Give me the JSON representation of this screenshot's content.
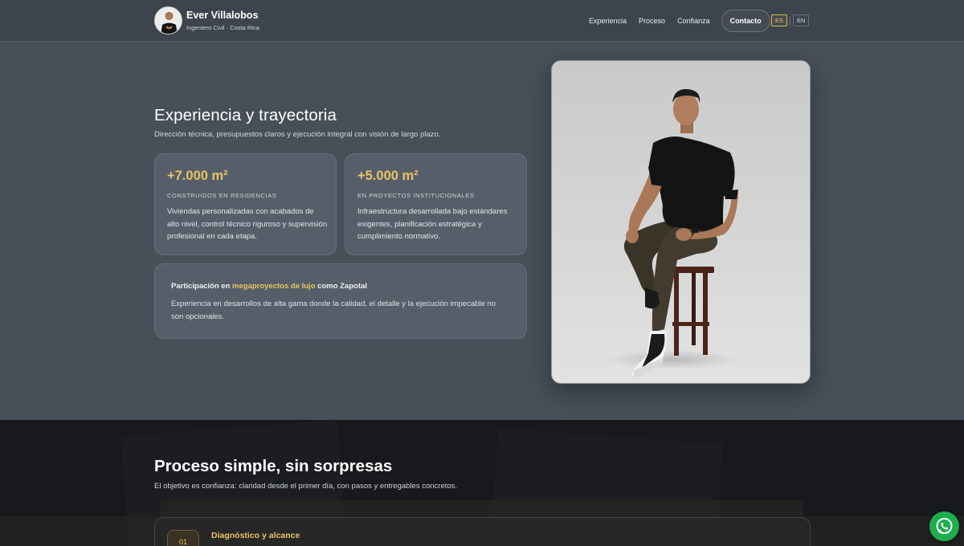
{
  "header": {
    "name": "Ever Villalobos",
    "subtitle": "Ingeniero Civil · Costa Rica",
    "nav": [
      "Experiencia",
      "Proceso",
      "Confianza"
    ],
    "contact_label": "Contacto",
    "lang": {
      "es": "ES",
      "en": "EN",
      "active": "ES"
    }
  },
  "hero": {
    "title": "Experiencia y trayectoria",
    "subtitle": "Dirección técnica, presupuestos claros y ejecución integral con visión de largo plazo.",
    "stats": [
      {
        "value": "+7.000 m²",
        "label": "CONSTRUIDOS EN RESIDENCIAS",
        "desc": "Viviendas personalizadas con acabados de alto nivel, control técnico riguroso y supervisión profesional en cada etapa."
      },
      {
        "value": "+5.000 m²",
        "label": "EN PROYECTOS INSTITUCIONALES",
        "desc": "Infraestructura desarrollada bajo estándares exigentes, planificación estratégica y cumplimiento normativo."
      }
    ],
    "participation": {
      "prefix": "Participación en",
      "highlight": "megaproyectos de lujo",
      "suffix": "como Zapotal",
      "desc": "Experiencia en desarrollos de alta gama donde la calidad, el detalle y la ejecución impecable no son opcionales."
    }
  },
  "process": {
    "title": "Proceso simple, sin sorpresas",
    "subtitle": "El objetivo es confianza: claridad desde el primer día, con pasos y entregables concretos.",
    "steps": [
      {
        "num": "01",
        "title": "Diagnóstico y alcance"
      }
    ]
  },
  "colors": {
    "accent": "#e8c463",
    "background": "#474f59",
    "header": "#3d444d",
    "card": "#565f69",
    "dark_section": "#1b1d21",
    "whatsapp": "#1fae4f"
  },
  "icons": {
    "whatsapp": "whatsapp-icon",
    "avatar": "profile-photo"
  }
}
